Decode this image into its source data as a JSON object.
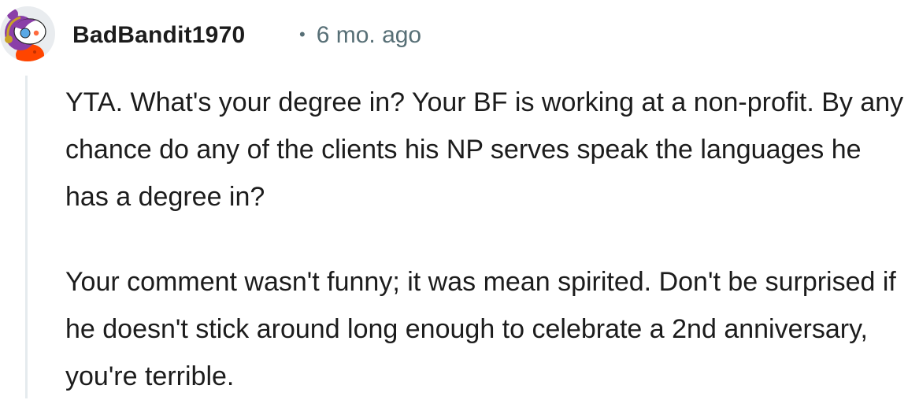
{
  "comment": {
    "author": "BadBandit1970",
    "separator": "•",
    "timestamp": "6 mo. ago",
    "paragraphs": [
      "YTA. What's your degree in? Your BF is working at a non-profit. By any chance do any of the clients his NP serves speak the languages he has a degree in?",
      "Your comment wasn't funny; it was mean spirited. Don't be surprised if he doesn't stick around long enough to celebrate a 2nd anniversary, you're terrible."
    ],
    "avatar_icon": "snoo-avatar-icon"
  },
  "colors": {
    "text": "#1c1c1c",
    "meta": "#576f76",
    "thread_line": "#e5ebee",
    "avatar_hair": "#8a3fa8",
    "avatar_shirt": "#ff4500"
  }
}
